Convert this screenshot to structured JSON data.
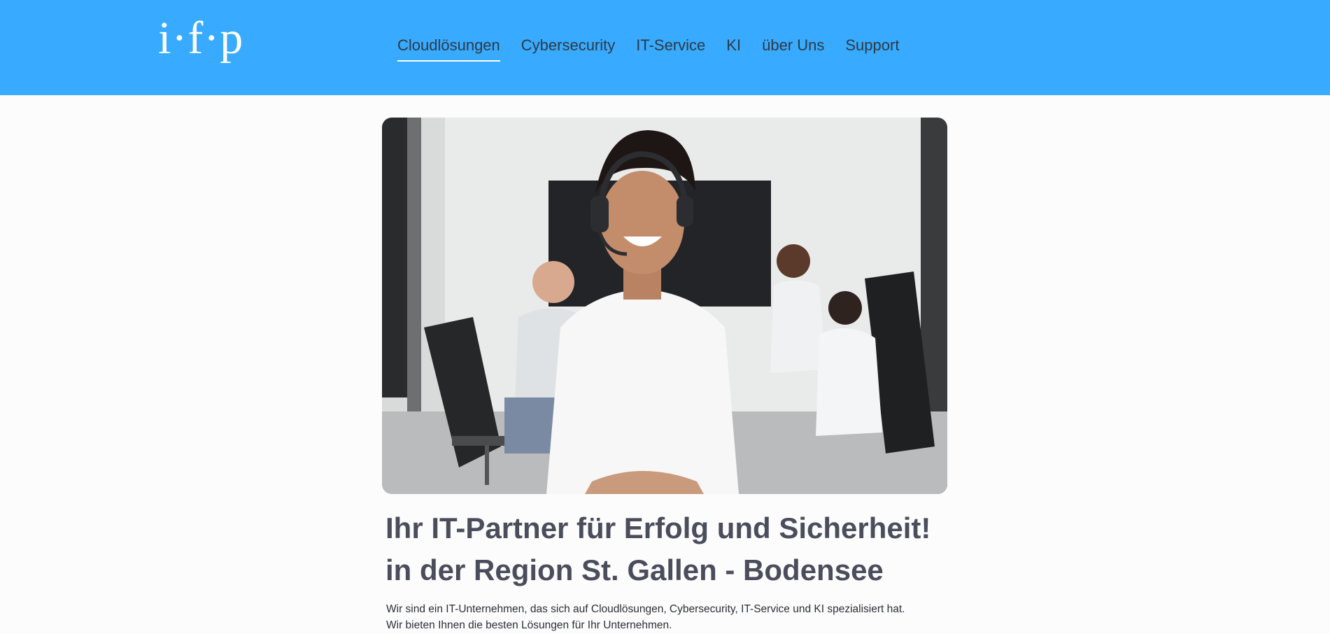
{
  "brand": {
    "logo_text": "i·f·p"
  },
  "nav": {
    "items": [
      {
        "label": "Cloudlösungen",
        "active": true
      },
      {
        "label": "Cybersecurity",
        "active": false
      },
      {
        "label": "IT-Service",
        "active": false
      },
      {
        "label": "KI",
        "active": false
      },
      {
        "label": "über Uns",
        "active": false
      },
      {
        "label": "Support",
        "active": false
      }
    ]
  },
  "hero": {
    "image_icon": "hero-photo-icon"
  },
  "content": {
    "headline_line1": "Ihr IT-Partner für Erfolg und Sicherheit!",
    "headline_line2": "in der Region St. Gallen - Bodensee",
    "intro_line1": "Wir sind ein IT-Unternehmen, das sich auf Cloudlösungen, Cybersecurity, IT-Service und KI spezialisiert hat.",
    "intro_line2": "Wir bieten Ihnen die besten Lösungen für Ihr Unternehmen."
  },
  "colors": {
    "header_bg": "#38aaff",
    "nav_text": "#2e3a44",
    "headline": "#4a4d5c",
    "page_bg": "#fcfcfc"
  }
}
